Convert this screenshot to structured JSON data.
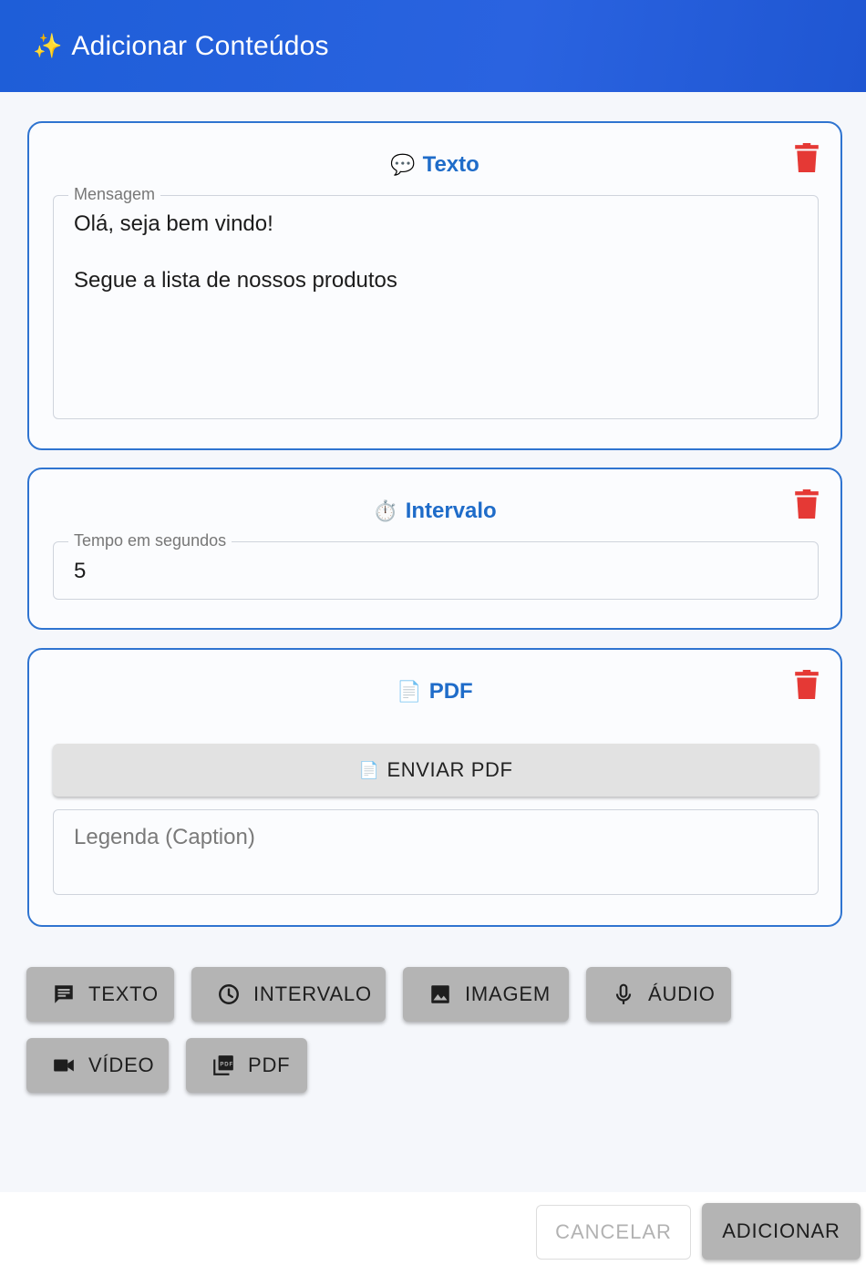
{
  "header": {
    "title": "Adicionar Conteúdos",
    "icon": "sparkles-icon"
  },
  "cards": {
    "texto": {
      "title": "Texto",
      "emoji": "💬",
      "field_label": "Mensagem",
      "message": "Olá, seja bem vindo!\n\nSegue a lista de nossos produtos"
    },
    "intervalo": {
      "title": "Intervalo",
      "emoji": "⏱️",
      "field_label": "Tempo em segundos",
      "value": "5"
    },
    "pdf": {
      "title": "PDF",
      "emoji": "📄",
      "upload_label": "ENVIAR PDF",
      "caption_placeholder": "Legenda (Caption)"
    }
  },
  "add_buttons": {
    "texto": "TEXTO",
    "intervalo": "INTERVALO",
    "imagem": "IMAGEM",
    "audio": "ÁUDIO",
    "video": "VÍDEO",
    "pdf": "PDF"
  },
  "footer": {
    "cancel": "CANCELAR",
    "add": "ADICIONAR"
  },
  "colors": {
    "header": "#1e5ed8",
    "accent": "#1f6cc9",
    "delete": "#e53935"
  }
}
